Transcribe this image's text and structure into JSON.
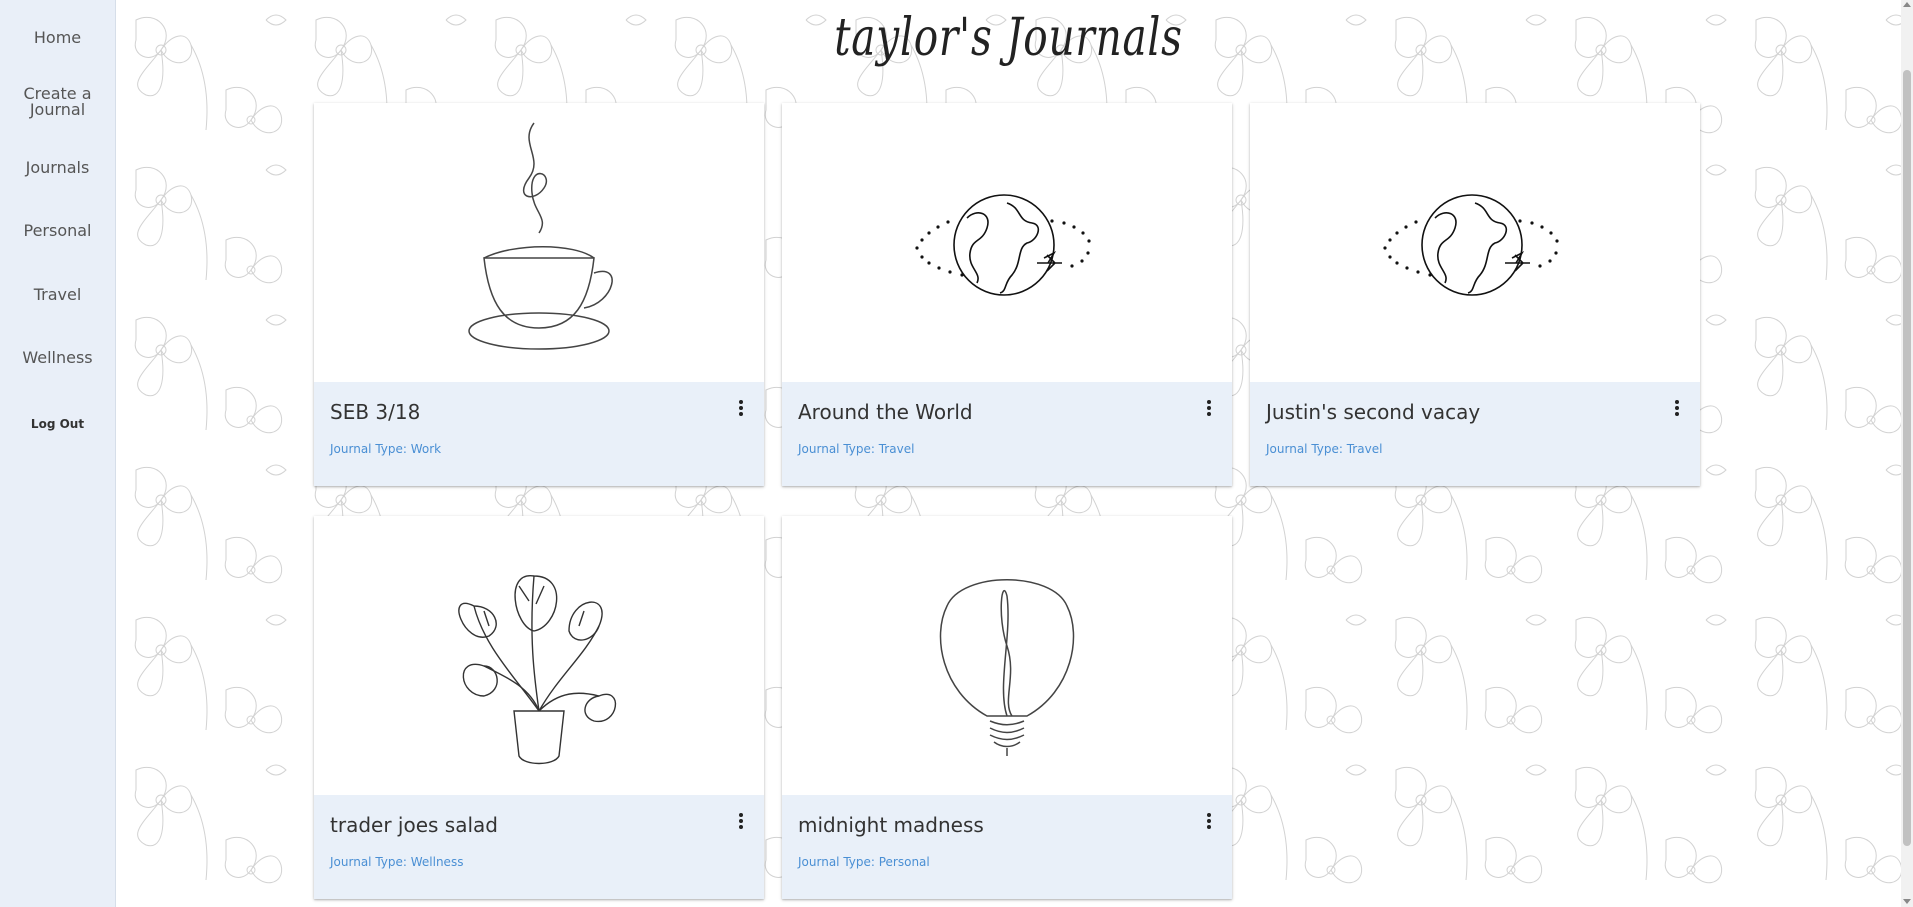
{
  "sidebar": {
    "items": [
      {
        "label": "Home"
      },
      {
        "label": "Create a\nJournal"
      },
      {
        "label": "Journals"
      },
      {
        "label": "Personal"
      },
      {
        "label": "Travel"
      },
      {
        "label": "Wellness"
      },
      {
        "label": "Log Out"
      }
    ]
  },
  "page": {
    "title": "taylor's Journals"
  },
  "journals": [
    {
      "title": "SEB 3/18",
      "type_label": "Journal Type: Work",
      "icon": "coffee-cup-icon"
    },
    {
      "title": "Around the World",
      "type_label": "Journal Type: Travel",
      "icon": "globe-airplane-icon"
    },
    {
      "title": "Justin's second vacay",
      "type_label": "Journal Type: Travel",
      "icon": "globe-airplane-icon"
    },
    {
      "title": "trader joes salad",
      "type_label": "Journal Type: Wellness",
      "icon": "potted-plant-icon"
    },
    {
      "title": "midnight madness",
      "type_label": "Journal Type: Personal",
      "icon": "lightbulb-icon"
    }
  ],
  "colors": {
    "sidebar_bg": "#e9eff8",
    "card_info_bg": "#e9f0f9",
    "type_text": "#4a8fd4"
  }
}
